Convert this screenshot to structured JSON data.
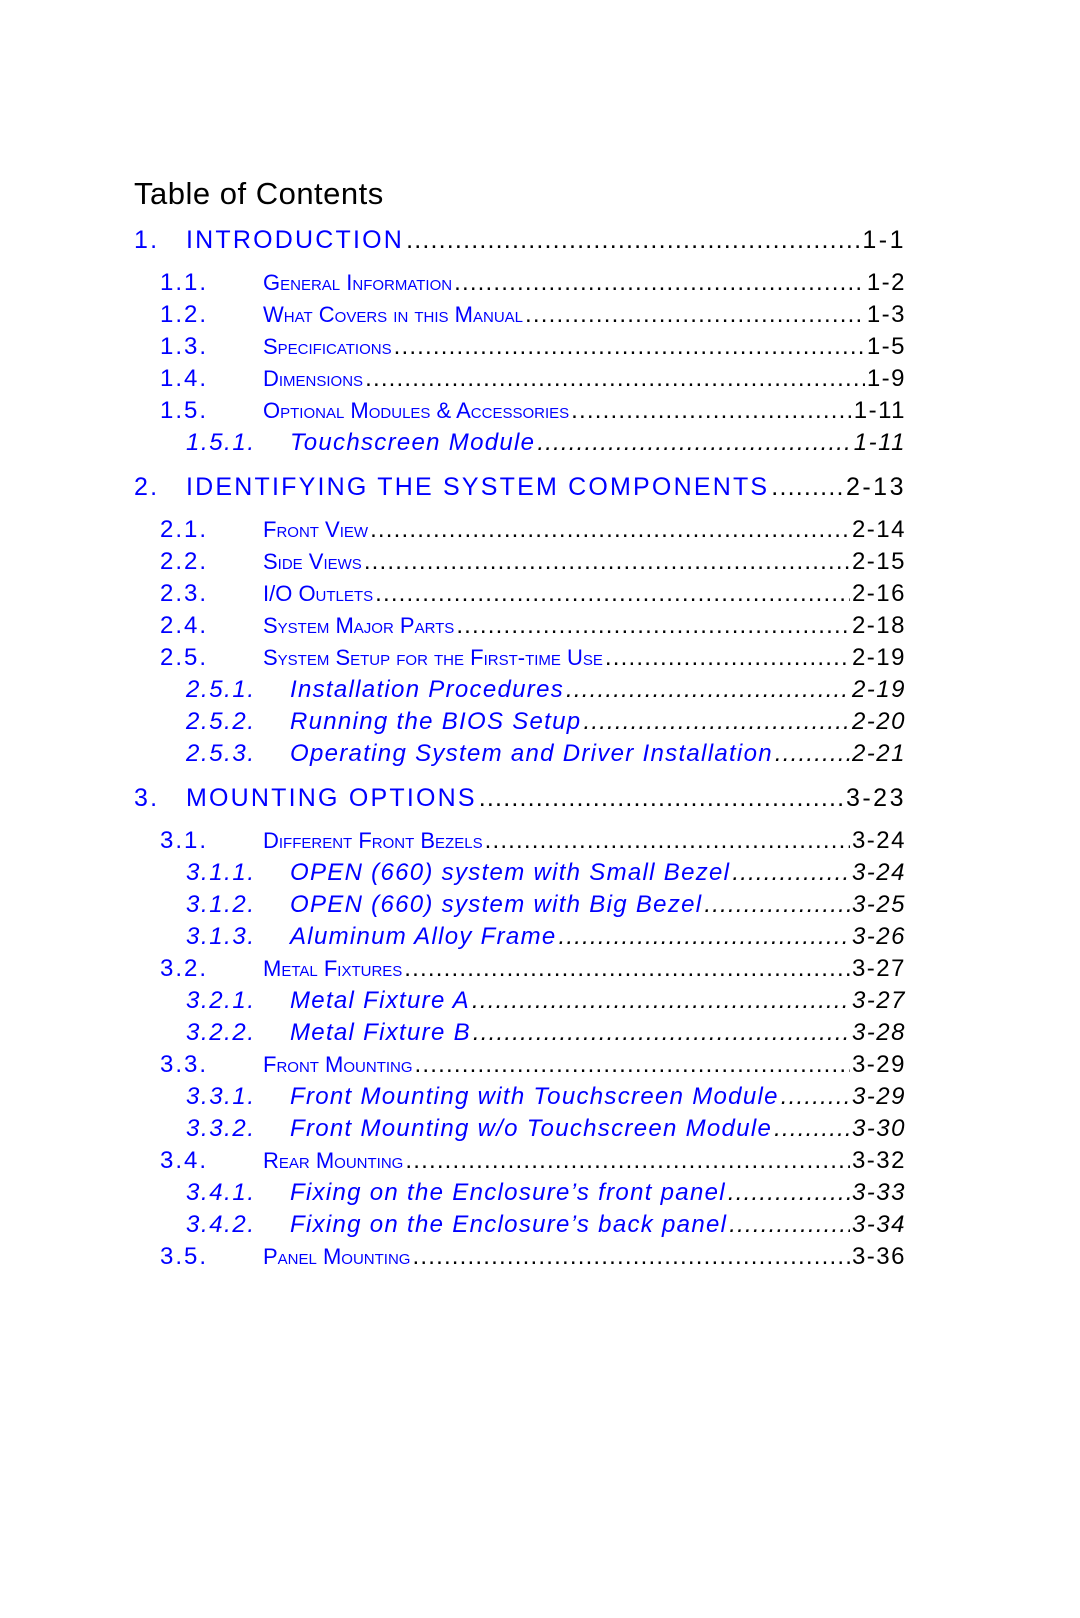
{
  "toc": {
    "title": "Table of Contents",
    "colors": {
      "entry_text": "#0000ff",
      "leader_and_page": "#000000"
    },
    "entries": [
      {
        "level": 1,
        "num": "1.",
        "title": "INTRODUCTION",
        "page": "1-1"
      },
      {
        "level": 2,
        "num": "1.1.",
        "title": "General Information",
        "page": "1-2"
      },
      {
        "level": 2,
        "num": "1.2.",
        "title": "What Covers in this Manual",
        "page": "1-3"
      },
      {
        "level": 2,
        "num": "1.3.",
        "title": "Specifications",
        "page": "1-5"
      },
      {
        "level": 2,
        "num": "1.4.",
        "title": "Dimensions",
        "page": "1-9"
      },
      {
        "level": 2,
        "num": "1.5.",
        "title": "Optional Modules & Accessories",
        "page": "1-11"
      },
      {
        "level": 3,
        "num": "1.5.1.",
        "title": "Touchscreen Module",
        "page": "1-11"
      },
      {
        "level": 1,
        "num": "2.",
        "title": "IDENTIFYING THE SYSTEM COMPONENTS",
        "page": "2-13"
      },
      {
        "level": 2,
        "num": "2.1.",
        "title": "Front View",
        "page": "2-14"
      },
      {
        "level": 2,
        "num": "2.2.",
        "title": "Side Views",
        "page": "2-15"
      },
      {
        "level": 2,
        "num": "2.3.",
        "title": "I/O Outlets",
        "page": "2-16"
      },
      {
        "level": 2,
        "num": "2.4.",
        "title": "System Major Parts",
        "page": "2-18"
      },
      {
        "level": 2,
        "num": "2.5.",
        "title": "System Setup for the First-time Use",
        "page": "2-19"
      },
      {
        "level": 3,
        "num": "2.5.1.",
        "title": "Installation Procedures",
        "page": "2-19"
      },
      {
        "level": 3,
        "num": "2.5.2.",
        "title": "Running the BIOS Setup",
        "page": "2-20"
      },
      {
        "level": 3,
        "num": "2.5.3.",
        "title": "Operating System and Driver Installation",
        "page": "2-21"
      },
      {
        "level": 1,
        "num": "3.",
        "title": "MOUNTING OPTIONS",
        "page": "3-23"
      },
      {
        "level": 2,
        "num": "3.1.",
        "title": "Different Front Bezels",
        "page": "3-24"
      },
      {
        "level": 3,
        "num": "3.1.1.",
        "title": "OPEN (660) system with Small Bezel",
        "page": "3-24"
      },
      {
        "level": 3,
        "num": "3.1.2.",
        "title": "OPEN (660) system with Big Bezel",
        "page": "3-25"
      },
      {
        "level": 3,
        "num": "3.1.3.",
        "title": "Aluminum Alloy Frame",
        "page": "3-26"
      },
      {
        "level": 2,
        "num": "3.2.",
        "title": "Metal Fixtures",
        "page": "3-27"
      },
      {
        "level": 3,
        "num": "3.2.1.",
        "title": "Metal  Fixture A",
        "page": "3-27"
      },
      {
        "level": 3,
        "num": "3.2.2.",
        "title": "Metal Fixture B",
        "page": "3-28"
      },
      {
        "level": 2,
        "num": "3.3.",
        "title": "Front Mounting",
        "page": "3-29"
      },
      {
        "level": 3,
        "num": "3.3.1.",
        "title": "Front Mounting with Touchscreen Module",
        "page": "3-29"
      },
      {
        "level": 3,
        "num": "3.3.2.",
        "title": "Front Mounting w/o Touchscreen Module",
        "page": "3-30"
      },
      {
        "level": 2,
        "num": "3.4.",
        "title": "Rear Mounting",
        "page": "3-32"
      },
      {
        "level": 3,
        "num": "3.4.1.",
        "title": "Fixing on the Enclosure’s front panel",
        "page": "3-33"
      },
      {
        "level": 3,
        "num": "3.4.2.",
        "title": "Fixing on the Enclosure’s back panel",
        "page": "3-34"
      },
      {
        "level": 2,
        "num": "3.5.",
        "title": "Panel Mounting",
        "page": "3-36"
      }
    ]
  }
}
